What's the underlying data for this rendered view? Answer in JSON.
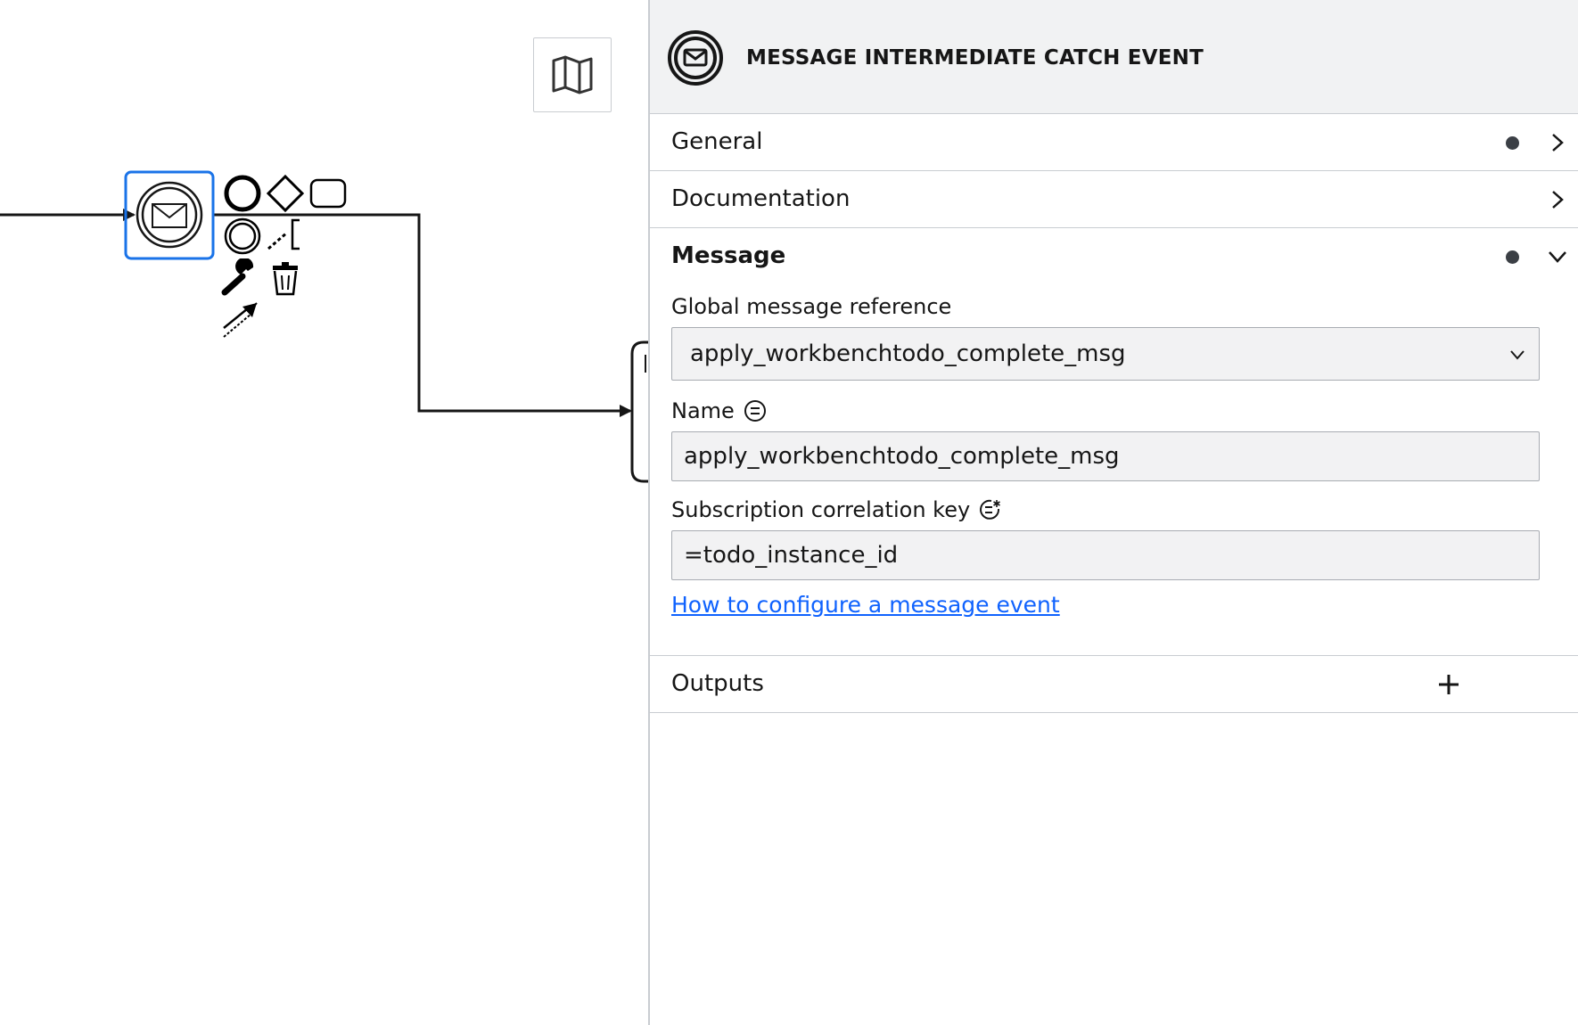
{
  "canvas": {
    "minimap_icon": "map-icon",
    "context_pad": {
      "icons": [
        "end-event-icon",
        "gateway-icon",
        "task-icon",
        "intermediate-event-icon",
        "text-annotation-icon",
        "change-type-wrench-icon",
        "delete-trash-icon",
        "connect-arrow-icon"
      ]
    },
    "selection_color": "#1a73e8"
  },
  "panel": {
    "header": {
      "icon": "message-catch-event-icon",
      "title": "MESSAGE INTERMEDIATE CATCH EVENT"
    },
    "groups": {
      "general": {
        "label": "General"
      },
      "documentation": {
        "label": "Documentation"
      },
      "message": {
        "label": "Message",
        "global_ref_label": "Global message reference",
        "global_ref_value": "apply_workbenchtodo_complete_msg",
        "name_label": "Name",
        "name_value": "apply_workbenchtodo_complete_msg",
        "correlation_label": "Subscription correlation key",
        "correlation_value": "=todo_instance_id",
        "help_link": "How to configure a message event"
      },
      "outputs": {
        "label": "Outputs"
      }
    },
    "colors": {
      "link": "#0f62fe",
      "header_bg": "#f1f2f3",
      "dot": "#3b3f45"
    }
  }
}
